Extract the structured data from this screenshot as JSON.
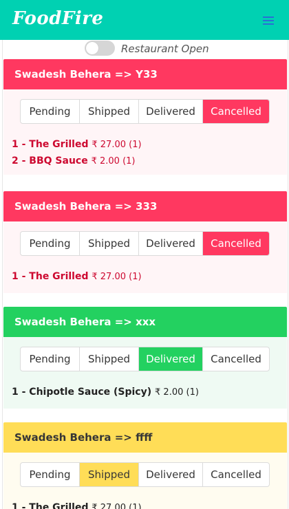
{
  "app": {
    "brand": "FoodFire"
  },
  "restaurant": {
    "status_label": "Restaurant Open",
    "open": false
  },
  "status_options": [
    "Pending",
    "Shipped",
    "Delivered",
    "Cancelled"
  ],
  "currency_symbol": "₹",
  "colors": {
    "navbar": "#00d1b2",
    "danger": "#ff3860",
    "success": "#23d160",
    "warning": "#ffdd57"
  },
  "orders": [
    {
      "title": "Swadesh Behera => Y33",
      "status": "Cancelled",
      "items": [
        {
          "label": "1 - The Grilled",
          "price": "₹ 27.00 (1)"
        },
        {
          "label": "2 - BBQ Sauce",
          "price": "₹ 2.00 (1)"
        }
      ]
    },
    {
      "title": "Swadesh Behera => 333",
      "status": "Cancelled",
      "items": [
        {
          "label": "1 - The Grilled",
          "price": "₹ 27.00 (1)"
        }
      ]
    },
    {
      "title": "Swadesh Behera => xxx",
      "status": "Delivered",
      "items": [
        {
          "label": "1 - Chipotle Sauce (Spicy)",
          "price": "₹ 2.00 (1)"
        }
      ]
    },
    {
      "title": "Swadesh Behera => ffff",
      "status": "Shipped",
      "items": [
        {
          "label": "1 - The Grilled",
          "price": "₹ 27.00 (1)"
        }
      ]
    }
  ]
}
